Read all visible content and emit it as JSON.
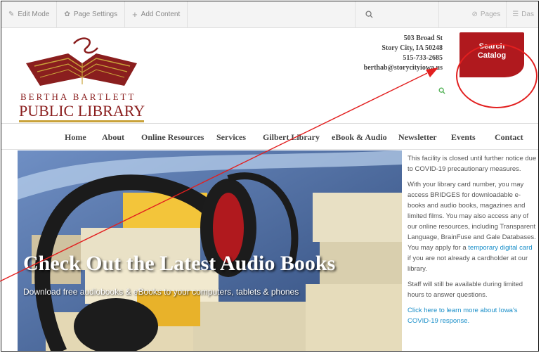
{
  "toolbar": {
    "edit_mode": "Edit Mode",
    "page_settings": "Page Settings",
    "add_content": "Add Content",
    "pages": "Pages",
    "dashboard": "Das"
  },
  "header": {
    "logo_line1": "BERTHA BARTLETT",
    "logo_line2": "PUBLIC LIBRARY",
    "address": {
      "street": "503 Broad St",
      "city": "Story City, IA 50248",
      "phone": "515-733-2685",
      "email": "berthab@storycityiowa.us"
    },
    "search_catalog_line1": "Search",
    "search_catalog_line2": "Catalog"
  },
  "nav": {
    "items": [
      "Home",
      "About",
      "Online Resources",
      "Services",
      "Gilbert Library",
      "eBook & Audio",
      "Newsletter",
      "Events",
      "Contact"
    ]
  },
  "hero": {
    "title": "Check Out the Latest Audio Books",
    "subtitle": "Download free audiobooks & eBooks to your computers, tablets & phones"
  },
  "sidebar": {
    "p1": "This facility is closed until further notice due to COVID-19 precautionary measures.",
    "p2_a": "With your library card number, you may access BRIDGES for downloadable e-books and audio books, magazines and limited films. You may also access any of our online resources, including Transparent Language, BrainFuse and Gale Databases. You may apply for a ",
    "p2_link": "temporary digital card",
    "p2_b": " if you are not already a cardholder at our library.",
    "p3": "Staff will still be available during limited hours to answer questions.",
    "p4_link": "Click here to learn more about Iowa's COVID-19 response."
  },
  "colors": {
    "brand_red": "#b0191e",
    "logo_red": "#8a1e1e",
    "logo_gold": "#c9a23a",
    "link_blue": "#1a8fc9",
    "annotation_red": "#e21f1f"
  }
}
